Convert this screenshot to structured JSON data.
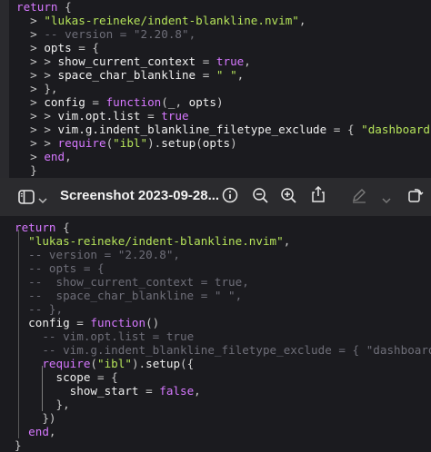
{
  "toolbar": {
    "title": "Screenshot 2023-09-28..."
  },
  "top_code": [
    [
      "return {"
    ],
    [
      "  > \"lukas-reineke/indent-blankline.nvim\","
    ],
    [
      "  > -- version = \"2.20.8\","
    ],
    [
      "  > opts = {"
    ],
    [
      "  > > show_current_context = true,"
    ],
    [
      "  > > space_char_blankline = \" \","
    ],
    [
      "  > },"
    ],
    [
      "  > config = function(_, opts)"
    ],
    [
      "  > > vim.opt.list = true"
    ],
    [
      "  > > vim.g.indent_blankline_filetype_exclude = { \"dashboard\" }"
    ],
    [
      "  > > require(\"ibl\").setup(opts)"
    ],
    [
      "  > end,"
    ],
    [
      "  }"
    ]
  ],
  "bottom_code": [
    [
      "return {"
    ],
    [
      "  \"lukas-reineke/indent-blankline.nvim\","
    ],
    [
      "  -- version = \"2.20.8\","
    ],
    [
      "  -- opts = {"
    ],
    [
      "  --  show_current_context = true,"
    ],
    [
      "  --  space_char_blankline = \" \","
    ],
    [
      "  -- },"
    ],
    [
      "  config = function()"
    ],
    [
      "    -- vim.opt.list = true"
    ],
    [
      "    -- vim.g.indent_blankline_filetype_exclude = { \"dashboard\" }"
    ],
    [
      "    require(\"ibl\").setup({"
    ],
    [
      "      scope = {"
    ],
    [
      "        show_start = false,"
    ],
    [
      "      },"
    ],
    [
      "    })"
    ],
    [
      "  end,"
    ],
    [
      "}"
    ]
  ],
  "colors": {
    "keyword": "#d678ff",
    "string": "#b5e35a",
    "comment": "#6e6e78",
    "toolbar_bg": "#2b2b2e"
  }
}
